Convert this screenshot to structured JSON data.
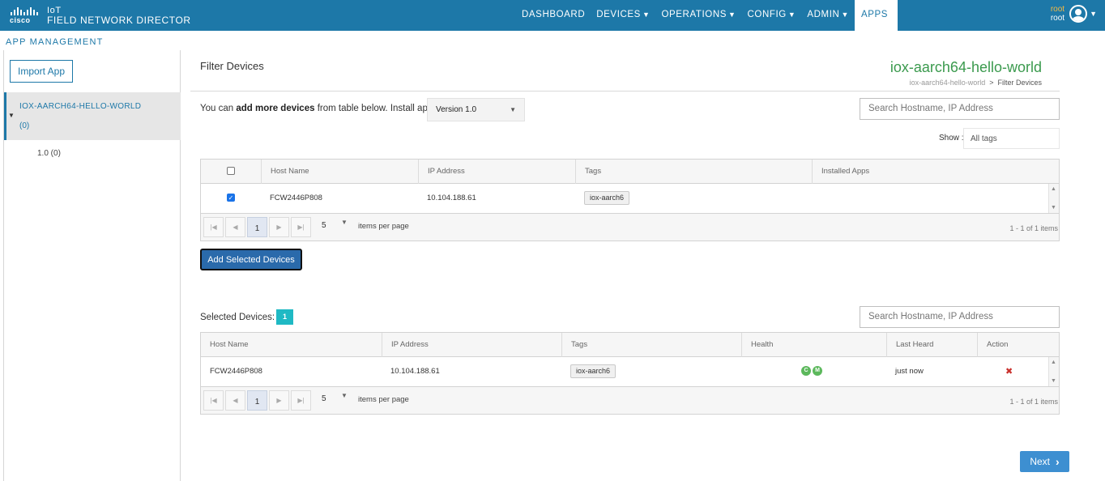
{
  "header": {
    "brand_word": "cisco",
    "product_line1": "IoT",
    "product_line2": "FIELD NETWORK DIRECTOR",
    "nav": [
      {
        "label": "DASHBOARD",
        "dropdown": false,
        "active": false
      },
      {
        "label": "DEVICES",
        "dropdown": true,
        "active": false
      },
      {
        "label": "OPERATIONS",
        "dropdown": true,
        "active": false
      },
      {
        "label": "CONFIG",
        "dropdown": true,
        "active": false
      },
      {
        "label": "ADMIN",
        "dropdown": true,
        "active": false
      },
      {
        "label": "APPS",
        "dropdown": false,
        "active": true
      }
    ],
    "user_role": "root",
    "user_name": "root"
  },
  "page_section": "APP MANAGEMENT",
  "sidebar": {
    "import_label": "Import App",
    "app_name": "IOX-AARCH64-HELLO-WORLD",
    "app_count": "(0)",
    "version_item": "1.0 (0)"
  },
  "main": {
    "title": "Filter Devices",
    "app_title": "iox-aarch64-hello-world",
    "breadcrumb": {
      "parent": "iox-aarch64-hello-world",
      "separator": ">",
      "current": "Filter Devices"
    },
    "add_message": {
      "prefix": "You can ",
      "bold": "add more devices",
      "suffix": " from table below. Install app"
    },
    "version_select": "Version 1.0",
    "search_placeholder": "Search Hostname, IP Address",
    "show_label": "Show :",
    "tags_select": "All tags",
    "add_button": "Add Selected Devices",
    "next_button": "Next"
  },
  "available_table": {
    "columns": [
      "Host Name",
      "IP Address",
      "Tags",
      "Installed Apps"
    ],
    "rows": [
      {
        "checked": true,
        "host": "FCW2446P808",
        "ip": "10.104.188.61",
        "tag": "iox-aarch6",
        "installed": ""
      }
    ],
    "pager": {
      "current_page": "1",
      "page_size": "5",
      "items_per_page": "items per page",
      "info": "1 - 1 of 1 items"
    }
  },
  "selected": {
    "label": "Selected Devices:",
    "count": "1",
    "search_placeholder": "Search Hostname, IP Address",
    "columns": [
      "Host Name",
      "IP Address",
      "Tags",
      "Health",
      "Last Heard",
      "Action"
    ],
    "rows": [
      {
        "host": "FCW2446P808",
        "ip": "10.104.188.61",
        "tag": "iox-aarch6",
        "health": [
          "C",
          "M"
        ],
        "last_heard": "just now",
        "action": "✖"
      }
    ],
    "pager": {
      "current_page": "1",
      "page_size": "5",
      "items_per_page": "items per page",
      "info": "1 - 1 of 1 items"
    }
  },
  "colors": {
    "brand": "#1d78a8",
    "app_title": "#3b9a4e",
    "badge": "#1fb9c4",
    "health": "#5cb85c",
    "primary_button": "#2a6aab",
    "next_button": "#3d8fd1"
  }
}
